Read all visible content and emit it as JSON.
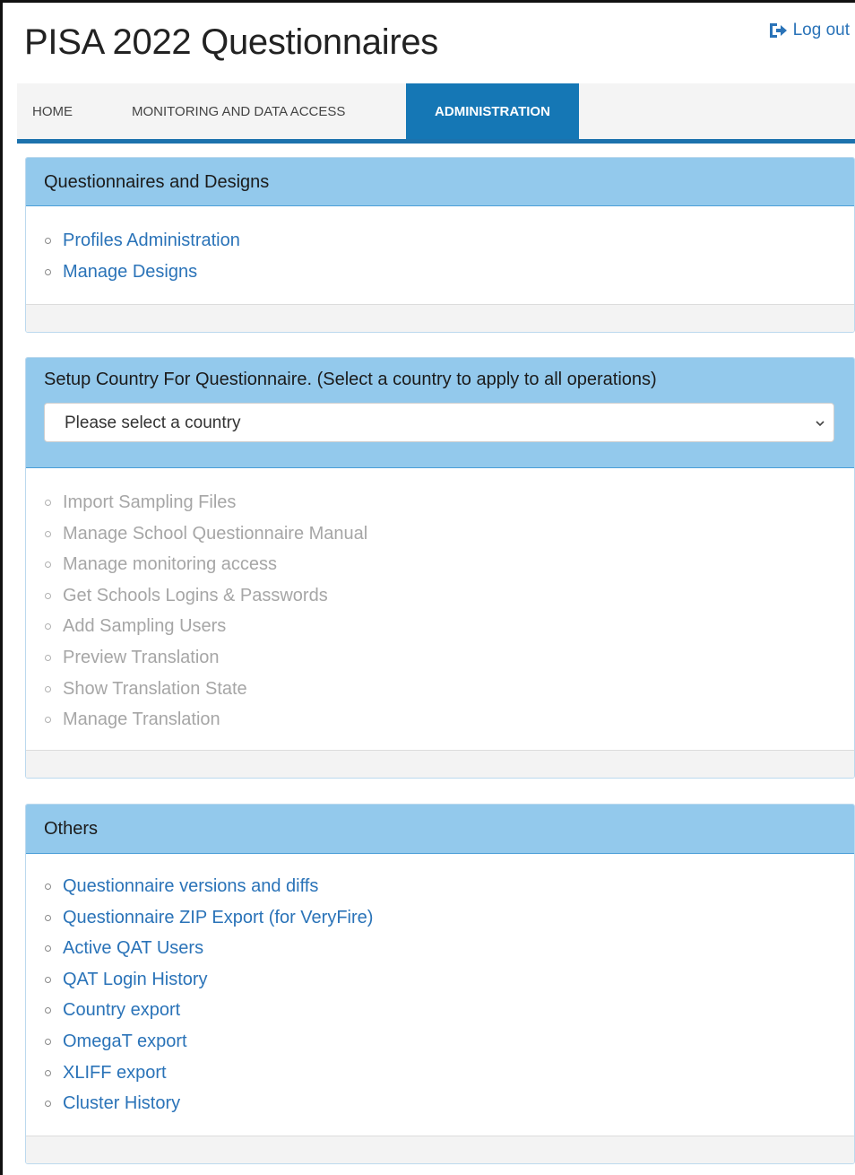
{
  "app": {
    "title": "PISA 2022 Questionnaires",
    "logout_label": "Log out"
  },
  "nav": {
    "tabs": [
      {
        "label": "HOME"
      },
      {
        "label": "MONITORING AND DATA ACCESS"
      },
      {
        "label": "ADMINISTRATION",
        "active": true
      }
    ]
  },
  "panels": {
    "designs": {
      "title": "Questionnaires and Designs",
      "links": [
        "Profiles Administration",
        "Manage Designs"
      ]
    },
    "setup": {
      "title": "Setup Country For Questionnaire. (Select a country to apply to all operations)",
      "select_value": "Please select a country",
      "links": [
        "Import Sampling Files",
        "Manage School Questionnaire Manual",
        "Manage monitoring access",
        "Get Schools Logins & Passwords",
        "Add Sampling Users",
        "Preview Translation",
        "Show Translation State",
        "Manage Translation"
      ]
    },
    "others": {
      "title": "Others",
      "links": [
        "Questionnaire versions and diffs",
        "Questionnaire ZIP Export (for VeryFire)",
        "Active QAT Users",
        "QAT Login History",
        "Country export",
        "OmegaT export",
        "XLIFF export",
        "Cluster History"
      ]
    }
  },
  "colors": {
    "accent": "#1577b5",
    "panel_header": "#93c9ec",
    "link": "#2a73b8",
    "disabled_link": "#a6a6a6"
  }
}
